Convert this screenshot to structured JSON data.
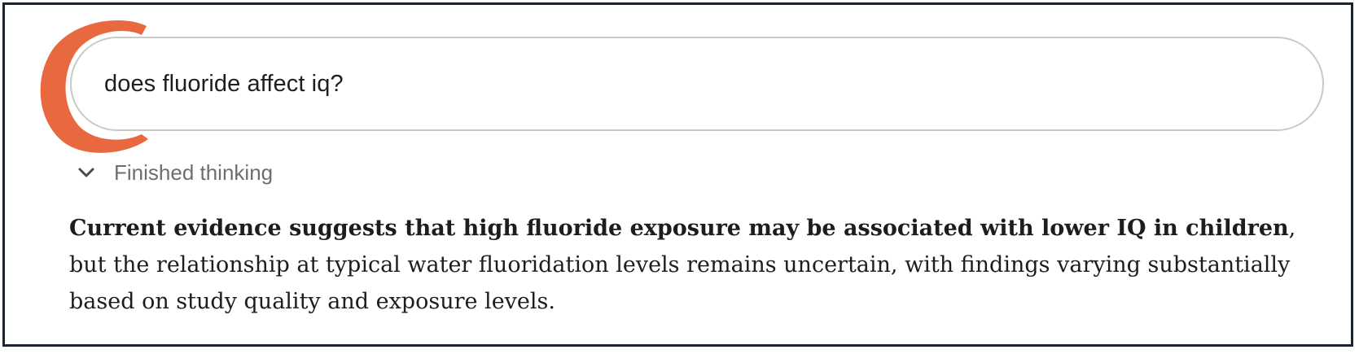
{
  "logo": {
    "icon": "claude-c-logo-icon",
    "color": "#e8693f"
  },
  "query": {
    "text": "does fluoride affect iq?"
  },
  "thinking": {
    "label": "Finished thinking",
    "icon": "chevron-down-icon",
    "expanded": false
  },
  "answer": {
    "bold_lead": "Current evidence suggests that high fluoride exposure may be associated with lower IQ in children",
    "rest": ", but the relationship at typical water fluoridation levels remains uncertain, with findings varying substantially based on study quality and exposure levels."
  },
  "colors": {
    "frame_border": "#16243a",
    "bubble_border": "#c9c9c9",
    "muted_text": "#6e6e6e",
    "body_text": "#1d1d1d"
  }
}
